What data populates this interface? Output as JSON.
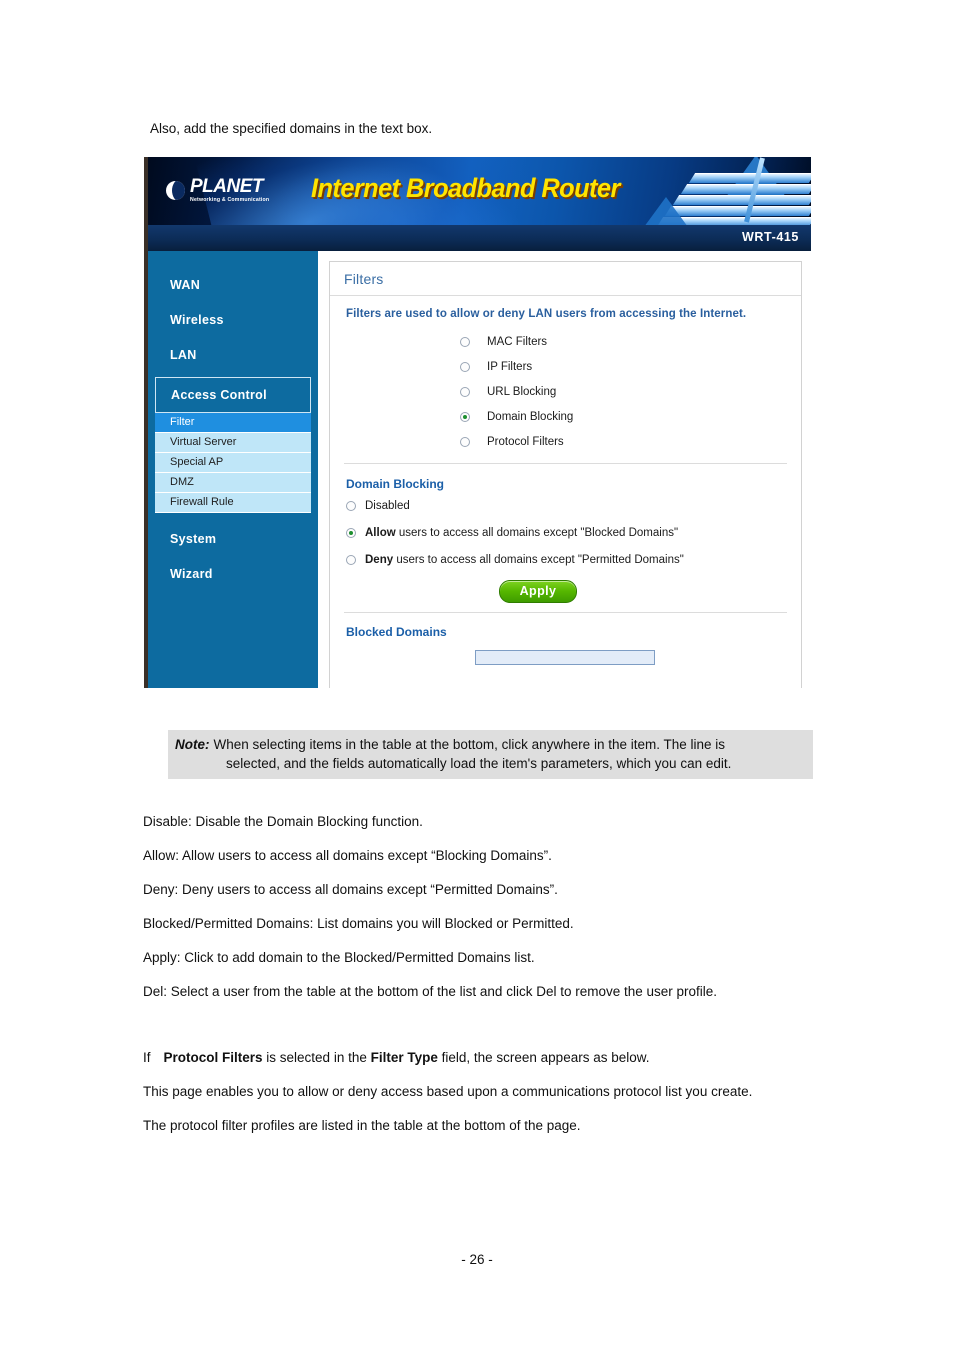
{
  "document": {
    "intro": "Also, add the specified domains in the text box.",
    "note": {
      "label": "Note:",
      "line1": "When selecting items in the table at the bottom, click anywhere in the item. The line is",
      "line2": "selected, and the fields automatically load the item's parameters, which you can edit."
    },
    "definitions": [
      "Disable: Disable the Domain Blocking function.",
      "Allow: Allow users to access all domains except “Blocking Domains”.",
      "Deny: Deny users to access all domains except “Permitted Domains”.",
      "Blocked/Permitted Domains: List domains you will Blocked or Permitted.",
      "Apply: Click to add domain to the Blocked/Permitted Domains list.",
      "Del: Select a user from the table at the bottom of the list and click Del to remove the user profile."
    ],
    "closing": {
      "if_word": "If",
      "bold1": "Protocol Filters",
      "mid": " is selected in the ",
      "bold2": "Filter Type",
      "end": " field, the screen appears as below.",
      "para2": "This page enables you to allow or deny access based upon a communications protocol list you create.",
      "para3": "The protocol filter profiles are listed in the table at the bottom of the page."
    },
    "page_number": "- 26 -"
  },
  "screenshot": {
    "banner": {
      "brand": "PLANET",
      "brand_tagline": "Networking & Communication",
      "title": "Internet Broadband Router",
      "model": "WRT-415"
    },
    "sidebar": {
      "items": [
        {
          "label": "WAN",
          "active": false
        },
        {
          "label": "Wireless",
          "active": false
        },
        {
          "label": "LAN",
          "active": false
        },
        {
          "label": "Access Control",
          "active": true
        }
      ],
      "subitems": [
        {
          "label": "Filter",
          "active": true
        },
        {
          "label": "Virtual Server",
          "active": false
        },
        {
          "label": "Special AP",
          "active": false
        },
        {
          "label": "DMZ",
          "active": false
        },
        {
          "label": "Firewall Rule",
          "active": false
        }
      ],
      "items_bottom": [
        {
          "label": "System"
        },
        {
          "label": "Wizard"
        }
      ]
    },
    "panel": {
      "title": "Filters",
      "description": "Filters are used to allow or deny LAN users from accessing the Internet.",
      "filter_types": [
        {
          "label": "MAC Filters",
          "selected": false
        },
        {
          "label": "IP Filters",
          "selected": false
        },
        {
          "label": "URL Blocking",
          "selected": false
        },
        {
          "label": "Domain Blocking",
          "selected": true
        },
        {
          "label": "Protocol Filters",
          "selected": false
        }
      ],
      "domain_blocking": {
        "heading": "Domain Blocking",
        "options": [
          {
            "bold": "",
            "text": "Disabled",
            "selected": false
          },
          {
            "bold": "Allow",
            "text": " users to access all domains except \"Blocked Domains\"",
            "selected": true
          },
          {
            "bold": "Deny",
            "text": " users to access all domains except \"Permitted Domains\"",
            "selected": false
          }
        ],
        "apply_label": "Apply"
      },
      "blocked_domains": {
        "heading": "Blocked Domains",
        "value": "",
        "placeholder": ""
      }
    }
  },
  "colors": {
    "sidebar_blue": "#0d6ba0",
    "sub_active_blue": "#1f8fe0",
    "banner_yellow": "#ffe400",
    "apply_green": "#56b700",
    "note_gray": "#dedede"
  }
}
